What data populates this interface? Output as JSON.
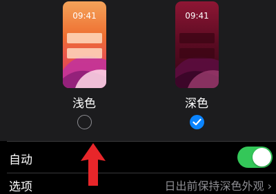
{
  "appearance": {
    "light": {
      "label": "浅色",
      "preview_time": "09:41",
      "selected": false
    },
    "dark": {
      "label": "深色",
      "preview_time": "09:41",
      "selected": true
    }
  },
  "auto": {
    "label": "自动",
    "enabled": true
  },
  "options": {
    "label": "选项",
    "value": "日出前保持深色外观"
  },
  "colors": {
    "accent_blue": "#0a84ff",
    "toggle_green": "#34c759",
    "annotation_red": "#e8262a",
    "background": "#000000",
    "group_background": "#1c1c1e"
  },
  "icons": [
    "checkmark-icon",
    "chevron-right-icon",
    "red-arrow-annotation"
  ]
}
